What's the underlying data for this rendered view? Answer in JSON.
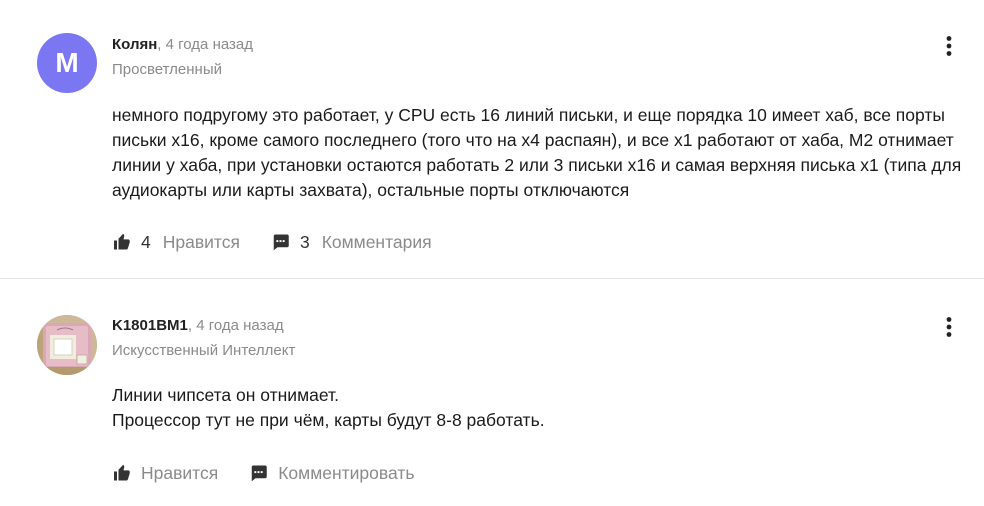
{
  "comments": [
    {
      "avatar_letter": "M",
      "avatar_color": "#7b77f2",
      "author": "Колян",
      "separator": ",",
      "time": "4 года назад",
      "status": "Просветленный",
      "text": "немного подругому это работает, у CPU есть 16 линий письки, и еще порядка 10 имеет хаб, все порты письки x16, кроме самого последнего (того что на x4 распаян), и все x1 работают от хаба, M2 отнимает линии у хаба, при установки остаются работать 2 или 3 письки x16 и самая верхняя писька x1 (типа для аудиокарты или карты захвата), остальные порты отключаются",
      "likes": "4",
      "like_label": "Нравится",
      "comments_count": "3",
      "comments_label": "Комментария",
      "menu_icon": "more-vertical-icon"
    },
    {
      "avatar_icon": "chip-photo-avatar",
      "author": "K1801BM1",
      "separator": ",",
      "time": "4 года назад",
      "status": "Искусственный Интеллект",
      "text_lines": [
        "Линии чипсета он отнимает.",
        "Процессор тут не при чём, карты будут 8-8 работать."
      ],
      "like_label": "Нравится",
      "comment_label": "Комментировать",
      "menu_icon": "more-vertical-icon"
    }
  ],
  "colors": {
    "muted_text": "#8a8a8a",
    "icon": "#333333",
    "divider": "#e6e6e6"
  }
}
